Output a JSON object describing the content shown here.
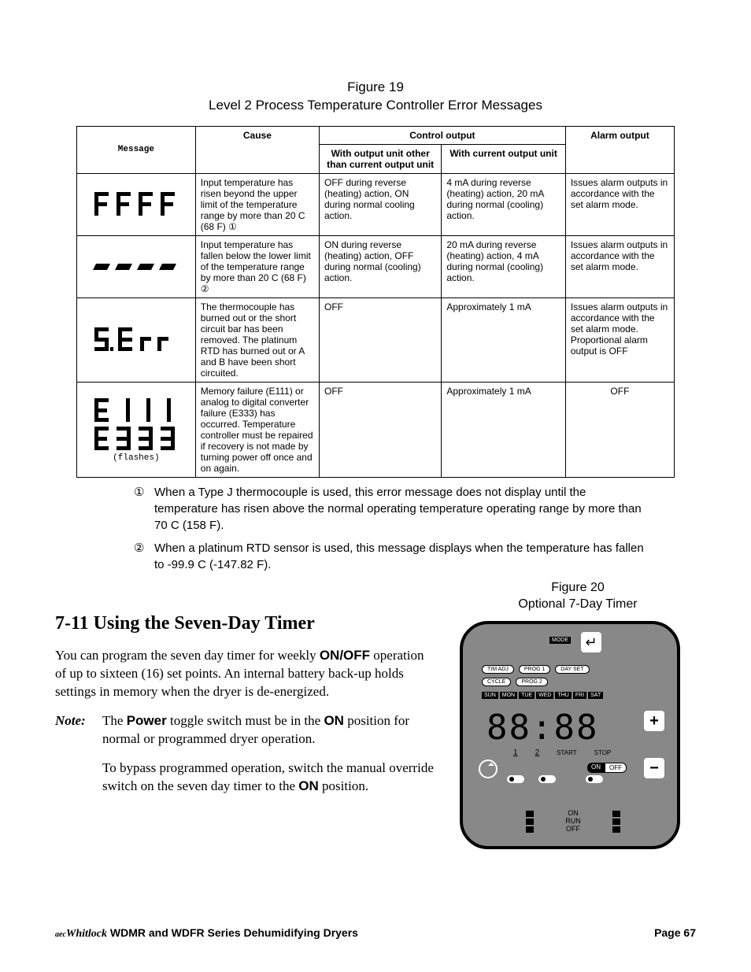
{
  "figure19": {
    "label_line1": "Figure 19",
    "label_line2": "Level 2 Process Temperature Controller Error Messages",
    "headers": {
      "message": "Message",
      "cause": "Cause",
      "control_output": "Control output",
      "co_other": "With output unit other than current output unit",
      "co_current": "With current output unit",
      "alarm": "Alarm output"
    },
    "rows": [
      {
        "msg_alt": "FFFF",
        "cause": "Input temperature has risen beyond the upper limit of the temperature range by more than 20 C (68 F) ①",
        "co_other": "OFF during reverse (heating) action, ON during normal cooling action.",
        "co_current": "4 mA during reverse (heating) action, 20 mA during normal (cooling) action.",
        "alarm": "Issues alarm outputs in accordance with the set alarm mode."
      },
      {
        "msg_alt": "----",
        "cause": "Input temperature has fallen below the lower limit of the temperature range by more than 20 C (68 F) ②",
        "co_other": "ON during reverse (heating) action, OFF during normal (cooling) action.",
        "co_current": "20 mA during reverse (heating) action, 4 mA during normal (cooling) action.",
        "alarm": "Issues alarm outputs in accordance with the set alarm mode."
      },
      {
        "msg_alt": "S.Err",
        "cause": "The thermocouple has burned out or the short circuit bar has been removed. The platinum RTD has burned out or A and B have been short circuited.",
        "co_other": "OFF",
        "co_current": "Approximately 1 mA",
        "alarm": "Issues alarm outputs in accordance with the set alarm mode. Proportional alarm output is OFF"
      },
      {
        "msg_alt": "E111 / E333 (flashes)",
        "sub": "(flashes)",
        "cause": "Memory failure (E111) or analog to digital converter failure (E333) has occurred. Temperature controller must be repaired if recovery is not made by turning power off once and on again.",
        "co_other": "OFF",
        "co_current": "Approximately 1 mA",
        "alarm": "OFF"
      }
    ],
    "note1": "When a Type J thermocouple is used, this error message does not display until the temperature has risen above the normal operating temperature operating range by more than 70 C (158 F).",
    "note2": "When a platinum RTD sensor is used, this message displays when the temperature has fallen to -99.9 C (-147.82 F).",
    "note_sym1": "①",
    "note_sym2": "②"
  },
  "section": {
    "heading": "7-11  Using the Seven-Day Timer",
    "p1a": "You can program the seven day timer for weekly ",
    "p1b": "ON/OFF",
    "p1c": " operation of up to sixteen (16) set points. An internal battery back-up holds settings in memory when the dryer is de-energized.",
    "note_label": "Note:",
    "p2a": "The ",
    "p2b": "Power",
    "p2c": " toggle switch must be in the ",
    "p2d": "ON",
    "p2e": " position for normal or programmed dryer operation.",
    "p3a": "To bypass programmed operation, switch the manual override switch on the seven day timer to the ",
    "p3b": "ON",
    "p3c": " position."
  },
  "figure20": {
    "label_line1": "Figure 20",
    "label_line2": "Optional 7-Day Timer",
    "mode": "MODE",
    "enter": "↵",
    "row1": [
      "TIM ADJ",
      "PROG 1",
      "DAY SET"
    ],
    "row2": [
      "CYCLE",
      "PROG 2"
    ],
    "days": [
      "SUN",
      "MON",
      "TUE",
      "WED",
      "THU",
      "FRI",
      "SAT"
    ],
    "lcd": "88:88",
    "plus": "+",
    "minus": "−",
    "one": "1",
    "two": "2",
    "start": "START",
    "stop": "STOP",
    "on": "ON",
    "off": "OFF",
    "sw_on": "ON",
    "sw_run": "RUN",
    "sw_off": "OFF"
  },
  "footer": {
    "brand": "Whitlock",
    "prefix": "aec",
    "title": " WDMR and WDFR Series Dehumidifying Dryers",
    "page": "Page 67"
  },
  "chart_data": {
    "type": "table",
    "title": "Level 2 Process Temperature Controller Error Messages",
    "columns": [
      "Message",
      "Cause",
      "Control output (other unit)",
      "Control output (current unit)",
      "Alarm output"
    ],
    "rows": [
      [
        "FFFF",
        "Input temp > upper limit +20 C (68 F)",
        "OFF reverse / ON normal cooling",
        "4 mA reverse / 20 mA normal cooling",
        "Alarm per set mode"
      ],
      [
        "----",
        "Input temp < lower limit -20 C (68 F)",
        "ON reverse / OFF normal cooling",
        "20 mA reverse / 4 mA normal cooling",
        "Alarm per set mode"
      ],
      [
        "S.Err",
        "Thermocouple burned out / short bar removed / Pt RTD burned or A-B shorted",
        "OFF",
        "~1 mA",
        "Alarm per set mode; proportional alarm OFF"
      ],
      [
        "E111/E333 (flashes)",
        "Memory failure (E111) or A/D converter failure (E333); repair if power cycle doesn't recover",
        "OFF",
        "~1 mA",
        "OFF"
      ]
    ]
  }
}
